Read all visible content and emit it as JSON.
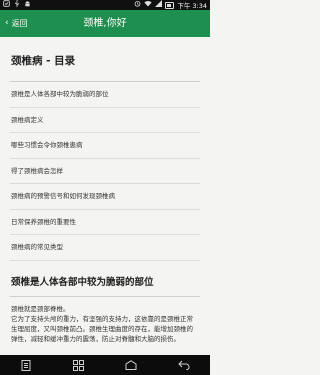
{
  "status_bar": {
    "time": "下午 3:34"
  },
  "header": {
    "back_label": "返回",
    "title": "颈椎,你好"
  },
  "toc": {
    "title": "颈椎病 - 目录",
    "items": [
      "颈椎是人体各部中较为脆弱的部位",
      "颈椎病定义",
      "哪些习惯会令你颈椎患病",
      "得了颈椎病会怎样",
      "颈椎病的预警信号和如何发现颈椎病",
      "日常保养颈椎的重要性",
      "颈椎病的常见类型"
    ]
  },
  "section": {
    "title": "颈椎是人体各部中较为脆弱的部位",
    "paragraphs": [
      "颈椎就是颈部脊椎。",
      "它为了支持头颅的重力，有坚强的支持力，这依靠的是颈椎正常生理屈度，又叫颈椎前凸。颈椎生理曲度的存在，能增加颈椎的弹性，减轻和缓冲重力的震荡，防止对脊髓和大脑的损伤。"
    ]
  }
}
